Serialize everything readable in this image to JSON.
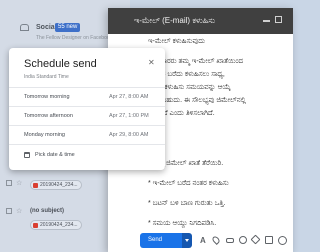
{
  "inbox": {
    "social_label": "Social",
    "social_badge": "55 new",
    "social_preview": "The Fellow Designer on Facebook",
    "items": [
      {
        "label": "(no subject)"
      },
      {
        "label": "20190424_234..."
      }
    ],
    "attachment": "20190424_234..."
  },
  "compose": {
    "title": "ಇ-ಮೇಲ್ (E-mail) ಕಳುಹಿಸು",
    "lines": [
      "ಇ-ಮೇಲ್ ಕಳುಹಿಸುವುದು",
      "ಬಳಕೆದಾರರು ತಮ್ಮ ಇ-ಮೇಲ್ ಖಾತೆಯಿಂದ",
      "ಸಂದೇಶ ಬರೆದು ಕಳುಹಿಸಲು ಸಾಧ್ಯ,",
      "ನಂತರ ಕಳುಹಿಸು ಸಮಯವನ್ನು ಆಯ್ಕೆ",
      "ಮಾಡಬಹುದು. ಈ ಸೌಲಭ್ಯವು ಜಿಮೇಲ್‌ನಲ್ಲಿ",
      "ಲಭ್ಯವಿದೆ ಎಂದು ತಿಳಿಸಲಾಗಿದೆ.",
      "",
      "",
      "* ನಿಮ್ಮ ಜಿಮೇಲ್ ಖಾತೆ ತೆರೆಯಿರಿ.",
      "* ಇ-ಮೇಲ್ ಬರೆದ ನಂತರ ಕಳುಹಿಸು",
      "* ಬಟನ್ ಬಳಿ ಬಾಣ ಗುರುತು ಒತ್ತಿ.",
      "* ಸಮಯ ಆಯ್ದು ನಿಗದಿಪಡಿಸಿ."
    ]
  },
  "toolbar": {
    "send_label": "Send",
    "format_label": "A"
  },
  "schedule": {
    "title": "Schedule send",
    "close_glyph": "✕",
    "timezone": "India Standard Time",
    "options": [
      {
        "label": "Tomorrow morning",
        "time": "Apr 27, 8:00 AM"
      },
      {
        "label": "Tomorrow afternoon",
        "time": "Apr 27, 1:00 PM"
      },
      {
        "label": "Monday morning",
        "time": "Apr 29, 8:00 AM"
      }
    ],
    "pick_label": "Pick date & time"
  },
  "colors": {
    "send_button": "#1a73e8",
    "header": "#404040",
    "attachment": "#d93f30"
  }
}
